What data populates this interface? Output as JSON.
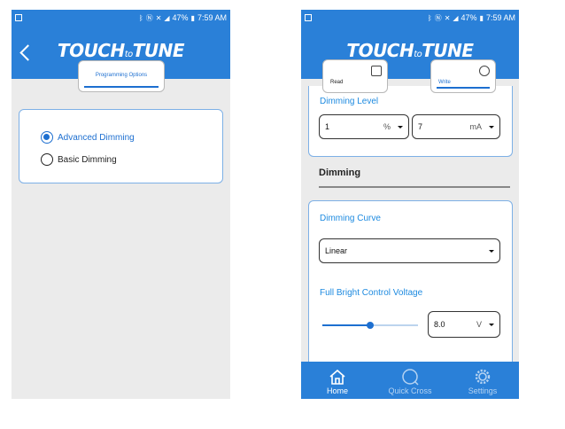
{
  "status_bar": {
    "battery": "47%",
    "time": "7:59 AM"
  },
  "logo": {
    "touch": "TOUCH",
    "to": "to",
    "tune": "TUNE"
  },
  "left_screen": {
    "tab_label": "Programming Options",
    "radio_options": [
      {
        "label": "Advanced Dimming",
        "selected": true
      },
      {
        "label": "Basic Dimming",
        "selected": false
      }
    ]
  },
  "right_screen": {
    "tabs": {
      "read_label": "Read",
      "write_label": "Write"
    },
    "dimming_level": {
      "label": "Dimming Level",
      "percent_value": "1",
      "percent_unit": "%",
      "ma_value": "7",
      "ma_unit": "mA"
    },
    "section_title": "Dimming",
    "dimming_curve": {
      "label": "Dimming Curve",
      "value": "Linear"
    },
    "full_bright": {
      "label": "Full Bright Control Voltage",
      "value": "8.0",
      "unit": "V",
      "slider_fraction": 0.5
    },
    "bottom_nav": {
      "home": "Home",
      "quick_cross": "Quick Cross",
      "settings": "Settings"
    }
  },
  "colors": {
    "accent": "#2a80d8",
    "link": "#1d6fd0",
    "card_border": "#7db0e6"
  }
}
